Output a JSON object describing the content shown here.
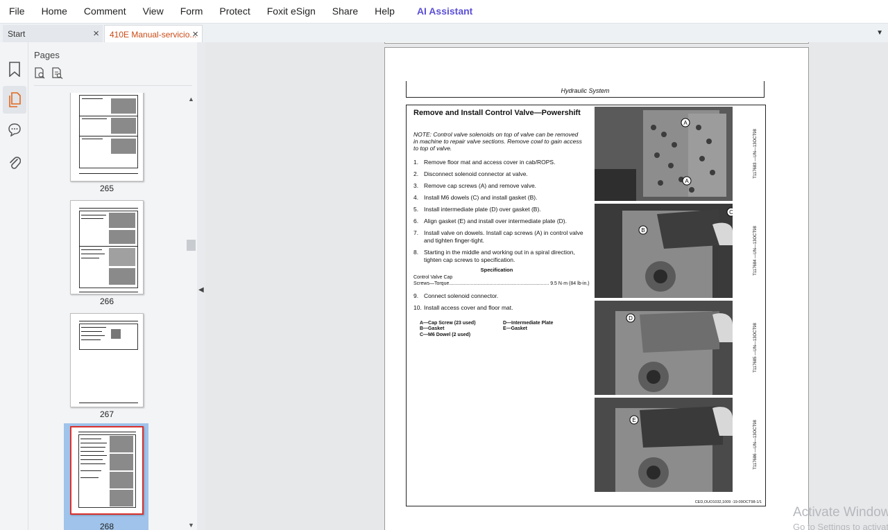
{
  "menu": {
    "items": [
      "File",
      "Home",
      "Comment",
      "View",
      "Form",
      "Protect",
      "Foxit eSign",
      "Share",
      "Help"
    ],
    "ai_assistant": "AI Assistant",
    "accent_color": "#5b4fd6"
  },
  "tabs": [
    {
      "label": "Start",
      "active": false
    },
    {
      "label": "410E Manual-servicio...",
      "active": true
    }
  ],
  "sidebar": {
    "icons": [
      "bookmark-icon",
      "pages-icon",
      "comment-icon",
      "attachment-icon"
    ],
    "active": "pages-icon"
  },
  "pages_panel": {
    "title": "Pages",
    "thumbnails": [
      {
        "page": "265",
        "selected": false
      },
      {
        "page": "266",
        "selected": false
      },
      {
        "page": "267",
        "selected": false
      },
      {
        "page": "268",
        "selected": true
      }
    ]
  },
  "document": {
    "header": "Hydraulic System",
    "section_title": "Remove and Install Control Valve—Powershift",
    "note": "NOTE: Control valve solenoids on top of valve can be removed in machine to repair valve sections. Remove cowl to gain access to top of valve.",
    "steps": [
      {
        "n": "1.",
        "text": "Remove floor mat and access cover in cab/ROPS."
      },
      {
        "n": "2.",
        "text": "Disconnect solenoid connector at valve."
      },
      {
        "n": "3.",
        "text": "Remove cap screws (A) and remove valve."
      },
      {
        "n": "4.",
        "text": "Install M6 dowels (C) and install gasket (B)."
      },
      {
        "n": "5.",
        "text": "Install intermediate plate (D) over gasket (B)."
      },
      {
        "n": "6.",
        "text": "Align gasket (E) and install over intermediate plate (D)."
      },
      {
        "n": "7.",
        "text": "Install valve on dowels. Install cap screws (A) in control valve and tighten finger-tight."
      },
      {
        "n": "8.",
        "text": "Starting in the middle and working out in a spiral direction, tighten cap screws to specification."
      }
    ],
    "specification": {
      "title": "Specification",
      "line1": "Control Valve Cap",
      "line2": "Screws—Torque.......................................................................... 9.5 N·m (84 lb-in.)"
    },
    "steps_after": [
      {
        "n": "9.",
        "text": "Connect solenoid connector."
      },
      {
        "n": "10.",
        "text": "Install access cover and floor mat."
      }
    ],
    "legend": {
      "a": "A—Cap Screw (23 used)",
      "b": "B—Gasket",
      "c": "C—M6 Dowel (2 used)",
      "d": "D—Intermediate Plate",
      "e": "E—Gasket"
    },
    "photos": [
      {
        "caption": "T117683 —UN—13OCT98",
        "labels": [
          "A",
          "A"
        ]
      },
      {
        "caption": "T117684 —UN—13OCT98",
        "labels": [
          "B",
          "C"
        ]
      },
      {
        "caption": "T117685 —UN—13OCT98",
        "labels": [
          "D"
        ]
      },
      {
        "caption": "T117686 —UN—13OCT98",
        "labels": [
          "E"
        ]
      }
    ],
    "footer_code": "CED,OUO1032,1009 -19-09OCT98-1/1"
  },
  "watermark": {
    "line1": "Activate Windows",
    "line2": "Go to Settings to activate Windows."
  }
}
